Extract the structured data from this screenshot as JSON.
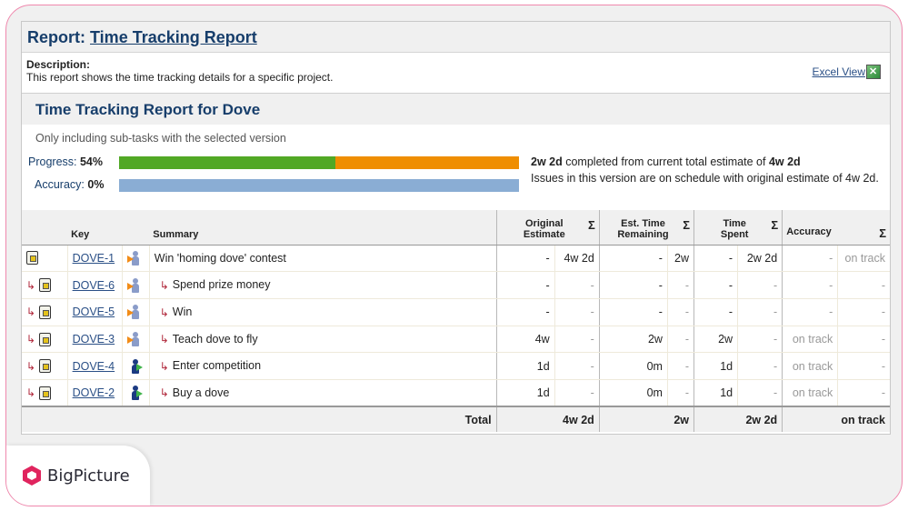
{
  "report": {
    "prefix": "Report:",
    "title": "Time Tracking Report",
    "description_label": "Description:",
    "description": "This report shows the time tracking details for a specific project.",
    "excel_view_label": "Excel View",
    "excel_icon": "excel-icon"
  },
  "section": {
    "title": "Time Tracking Report for Dove",
    "note": "Only including sub-tasks with the selected version"
  },
  "progress": {
    "label": "Progress:",
    "value": "54%",
    "fraction": 0.54,
    "done_color": "#51a825",
    "todo_color": "#ef8e01",
    "message_part1": "2w 2d",
    "message_part2": " completed from current total estimate of ",
    "message_part3": "4w 2d"
  },
  "accuracy": {
    "label": "Accuracy:",
    "value": "0%",
    "fraction": 0.0,
    "color": "#8aadd4",
    "message": "Issues in this version are on schedule with original estimate of 4w 2d."
  },
  "table": {
    "headers": {
      "key": "Key",
      "summary": "Summary",
      "original_estimate": "Original Estimate",
      "est_time_remaining": "Est. Time Remaining",
      "time_spent": "Time Spent",
      "accuracy": "Accuracy",
      "sigma": "Σ"
    },
    "rows": [
      {
        "key": "DOVE-1",
        "subtask": false,
        "assignee": "unassigned",
        "summary": "Win 'homing dove' contest",
        "orig": "-",
        "orig_sum": "4w 2d",
        "rem": "-",
        "rem_sum": "2w",
        "spent": "-",
        "spent_sum": "2w 2d",
        "acc": "-",
        "acc_sum": "on track"
      },
      {
        "key": "DOVE-6",
        "subtask": true,
        "assignee": "unassigned",
        "summary": "Spend prize money",
        "orig": "-",
        "orig_sum": "-",
        "rem": "-",
        "rem_sum": "-",
        "spent": "-",
        "spent_sum": "-",
        "acc": "-",
        "acc_sum": "-"
      },
      {
        "key": "DOVE-5",
        "subtask": true,
        "assignee": "unassigned",
        "summary": "Win",
        "orig": "-",
        "orig_sum": "-",
        "rem": "-",
        "rem_sum": "-",
        "spent": "-",
        "spent_sum": "-",
        "acc": "-",
        "acc_sum": "-"
      },
      {
        "key": "DOVE-3",
        "subtask": true,
        "assignee": "unassigned",
        "summary": "Teach dove to fly",
        "orig": "4w",
        "orig_sum": "-",
        "rem": "2w",
        "rem_sum": "-",
        "spent": "2w",
        "spent_sum": "-",
        "acc": "on track",
        "acc_sum": "-"
      },
      {
        "key": "DOVE-4",
        "subtask": true,
        "assignee": "assigned",
        "summary": "Enter competition",
        "orig": "1d",
        "orig_sum": "-",
        "rem": "0m",
        "rem_sum": "-",
        "spent": "1d",
        "spent_sum": "-",
        "acc": "on track",
        "acc_sum": "-"
      },
      {
        "key": "DOVE-2",
        "subtask": true,
        "assignee": "assigned",
        "summary": "Buy a dove",
        "orig": "1d",
        "orig_sum": "-",
        "rem": "0m",
        "rem_sum": "-",
        "spent": "1d",
        "spent_sum": "-",
        "acc": "on track",
        "acc_sum": "-"
      }
    ],
    "total": {
      "label": "Total",
      "orig": "4w 2d",
      "rem": "2w",
      "spent": "2w 2d",
      "acc": "on track"
    }
  },
  "brand": {
    "name": "BigPicture",
    "color": "#e0245e"
  }
}
